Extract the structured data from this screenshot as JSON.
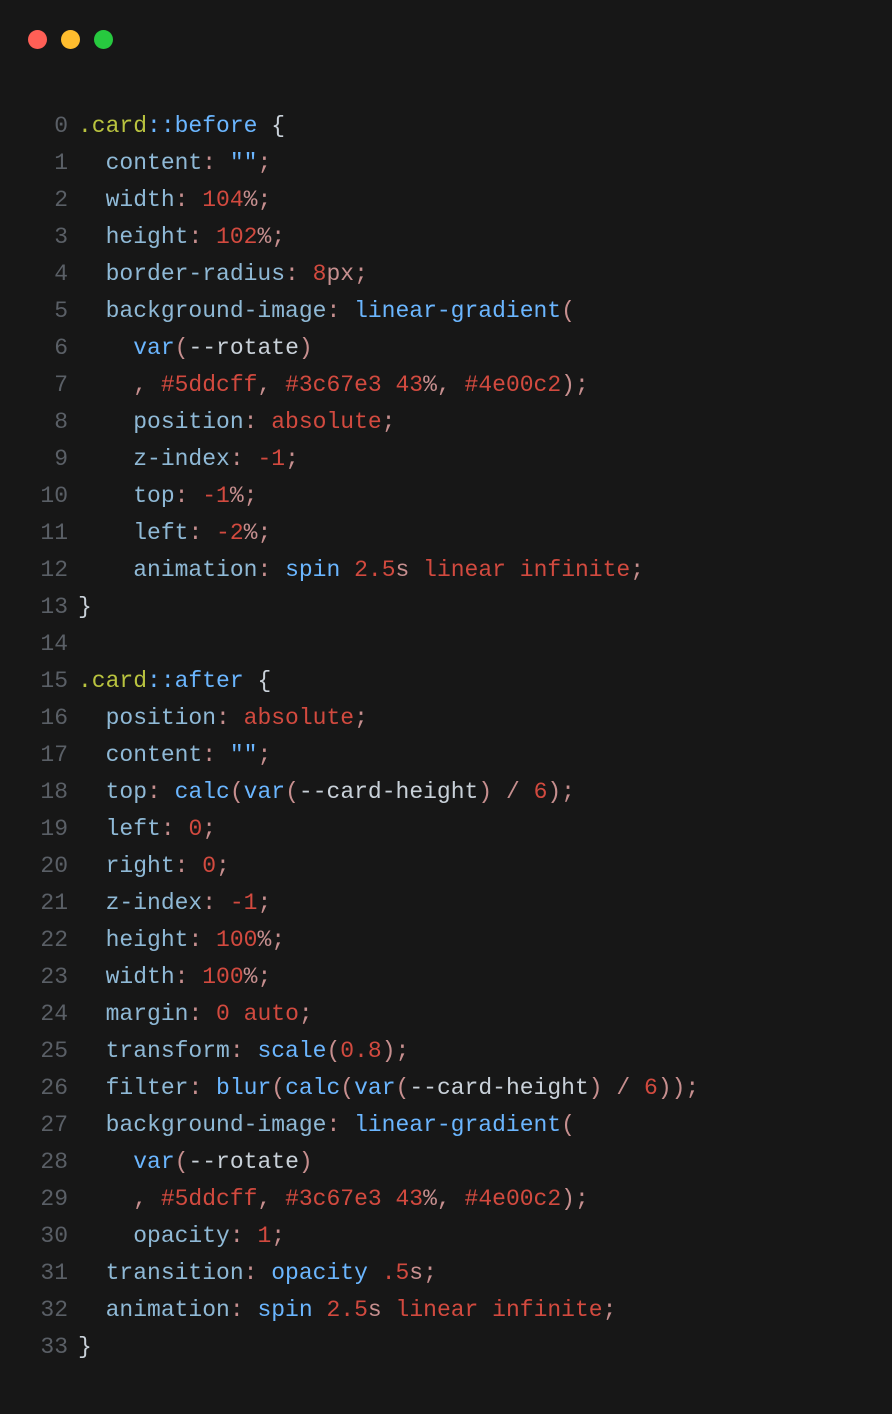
{
  "lines": [
    {
      "n": "0",
      "tokens": [
        [
          "c-sel",
          ".card"
        ],
        [
          "c-pse",
          "::before"
        ],
        [
          "c-brace",
          " {"
        ]
      ]
    },
    {
      "n": "1",
      "tokens": [
        [
          "",
          "  "
        ],
        [
          "c-prop",
          "content"
        ],
        [
          "c-punc",
          ": "
        ],
        [
          "c-str",
          "\"\""
        ],
        [
          "c-punc",
          ";"
        ]
      ]
    },
    {
      "n": "2",
      "tokens": [
        [
          "",
          "  "
        ],
        [
          "c-prop",
          "width"
        ],
        [
          "c-punc",
          ": "
        ],
        [
          "c-num",
          "104"
        ],
        [
          "c-unit",
          "%"
        ],
        [
          "c-punc",
          ";"
        ]
      ]
    },
    {
      "n": "3",
      "tokens": [
        [
          "",
          "  "
        ],
        [
          "c-prop",
          "height"
        ],
        [
          "c-punc",
          ": "
        ],
        [
          "c-num",
          "102"
        ],
        [
          "c-unit",
          "%"
        ],
        [
          "c-punc",
          ";"
        ]
      ]
    },
    {
      "n": "4",
      "tokens": [
        [
          "",
          "  "
        ],
        [
          "c-prop",
          "border-radius"
        ],
        [
          "c-punc",
          ": "
        ],
        [
          "c-num",
          "8"
        ],
        [
          "c-unit",
          "px"
        ],
        [
          "c-punc",
          ";"
        ]
      ]
    },
    {
      "n": "5",
      "tokens": [
        [
          "",
          "  "
        ],
        [
          "c-prop",
          "background-image"
        ],
        [
          "c-punc",
          ": "
        ],
        [
          "c-fn",
          "linear-gradient"
        ],
        [
          "c-punc",
          "("
        ]
      ]
    },
    {
      "n": "6",
      "tokens": [
        [
          "",
          "    "
        ],
        [
          "c-fn",
          "var"
        ],
        [
          "c-punc",
          "("
        ],
        [
          "c-varn",
          "--rotate"
        ],
        [
          "c-punc",
          ")"
        ]
      ]
    },
    {
      "n": "7",
      "tokens": [
        [
          "",
          "    "
        ],
        [
          "c-punc",
          ", "
        ],
        [
          "c-hex",
          "#5ddcff"
        ],
        [
          "c-punc",
          ", "
        ],
        [
          "c-hex",
          "#3c67e3"
        ],
        [
          "",
          " "
        ],
        [
          "c-num",
          "43"
        ],
        [
          "c-unit",
          "%"
        ],
        [
          "c-punc",
          ", "
        ],
        [
          "c-hex",
          "#4e00c2"
        ],
        [
          "c-punc",
          ");"
        ]
      ]
    },
    {
      "n": "8",
      "tokens": [
        [
          "",
          "    "
        ],
        [
          "c-prop",
          "position"
        ],
        [
          "c-punc",
          ": "
        ],
        [
          "c-kw",
          "absolute"
        ],
        [
          "c-punc",
          ";"
        ]
      ]
    },
    {
      "n": "9",
      "tokens": [
        [
          "",
          "    "
        ],
        [
          "c-prop",
          "z-index"
        ],
        [
          "c-punc",
          ": "
        ],
        [
          "c-num",
          "-1"
        ],
        [
          "c-punc",
          ";"
        ]
      ]
    },
    {
      "n": "10",
      "tokens": [
        [
          "",
          "    "
        ],
        [
          "c-prop",
          "top"
        ],
        [
          "c-punc",
          ": "
        ],
        [
          "c-num",
          "-1"
        ],
        [
          "c-unit",
          "%"
        ],
        [
          "c-punc",
          ";"
        ]
      ]
    },
    {
      "n": "11",
      "tokens": [
        [
          "",
          "    "
        ],
        [
          "c-prop",
          "left"
        ],
        [
          "c-punc",
          ": "
        ],
        [
          "c-num",
          "-2"
        ],
        [
          "c-unit",
          "%"
        ],
        [
          "c-punc",
          ";"
        ]
      ]
    },
    {
      "n": "12",
      "tokens": [
        [
          "",
          "    "
        ],
        [
          "c-prop",
          "animation"
        ],
        [
          "c-punc",
          ": "
        ],
        [
          "c-id",
          "spin"
        ],
        [
          "",
          " "
        ],
        [
          "c-num",
          "2.5"
        ],
        [
          "c-unit",
          "s"
        ],
        [
          "",
          " "
        ],
        [
          "c-kw",
          "linear"
        ],
        [
          "",
          " "
        ],
        [
          "c-kw",
          "infinite"
        ],
        [
          "c-punc",
          ";"
        ]
      ]
    },
    {
      "n": "13",
      "tokens": [
        [
          "c-brace",
          "}"
        ]
      ]
    },
    {
      "n": "14",
      "tokens": [
        [
          "",
          ""
        ]
      ]
    },
    {
      "n": "15",
      "tokens": [
        [
          "c-sel",
          ".card"
        ],
        [
          "c-pse",
          "::after"
        ],
        [
          "c-brace",
          " {"
        ]
      ]
    },
    {
      "n": "16",
      "tokens": [
        [
          "",
          "  "
        ],
        [
          "c-prop",
          "position"
        ],
        [
          "c-punc",
          ": "
        ],
        [
          "c-kw",
          "absolute"
        ],
        [
          "c-punc",
          ";"
        ]
      ]
    },
    {
      "n": "17",
      "tokens": [
        [
          "",
          "  "
        ],
        [
          "c-prop",
          "content"
        ],
        [
          "c-punc",
          ": "
        ],
        [
          "c-str",
          "\"\""
        ],
        [
          "c-punc",
          ";"
        ]
      ]
    },
    {
      "n": "18",
      "tokens": [
        [
          "",
          "  "
        ],
        [
          "c-prop",
          "top"
        ],
        [
          "c-punc",
          ": "
        ],
        [
          "c-fn",
          "calc"
        ],
        [
          "c-punc",
          "("
        ],
        [
          "c-fn",
          "var"
        ],
        [
          "c-punc",
          "("
        ],
        [
          "c-varn",
          "--card-height"
        ],
        [
          "c-punc",
          ") / "
        ],
        [
          "c-num",
          "6"
        ],
        [
          "c-punc",
          ");"
        ]
      ]
    },
    {
      "n": "19",
      "tokens": [
        [
          "",
          "  "
        ],
        [
          "c-prop",
          "left"
        ],
        [
          "c-punc",
          ": "
        ],
        [
          "c-num",
          "0"
        ],
        [
          "c-punc",
          ";"
        ]
      ]
    },
    {
      "n": "20",
      "tokens": [
        [
          "",
          "  "
        ],
        [
          "c-prop",
          "right"
        ],
        [
          "c-punc",
          ": "
        ],
        [
          "c-num",
          "0"
        ],
        [
          "c-punc",
          ";"
        ]
      ]
    },
    {
      "n": "21",
      "tokens": [
        [
          "",
          "  "
        ],
        [
          "c-prop",
          "z-index"
        ],
        [
          "c-punc",
          ": "
        ],
        [
          "c-num",
          "-1"
        ],
        [
          "c-punc",
          ";"
        ]
      ]
    },
    {
      "n": "22",
      "tokens": [
        [
          "",
          "  "
        ],
        [
          "c-prop",
          "height"
        ],
        [
          "c-punc",
          ": "
        ],
        [
          "c-num",
          "100"
        ],
        [
          "c-unit",
          "%"
        ],
        [
          "c-punc",
          ";"
        ]
      ]
    },
    {
      "n": "23",
      "tokens": [
        [
          "",
          "  "
        ],
        [
          "c-prop",
          "width"
        ],
        [
          "c-punc",
          ": "
        ],
        [
          "c-num",
          "100"
        ],
        [
          "c-unit",
          "%"
        ],
        [
          "c-punc",
          ";"
        ]
      ]
    },
    {
      "n": "24",
      "tokens": [
        [
          "",
          "  "
        ],
        [
          "c-prop",
          "margin"
        ],
        [
          "c-punc",
          ": "
        ],
        [
          "c-num",
          "0"
        ],
        [
          "",
          " "
        ],
        [
          "c-kw",
          "auto"
        ],
        [
          "c-punc",
          ";"
        ]
      ]
    },
    {
      "n": "25",
      "tokens": [
        [
          "",
          "  "
        ],
        [
          "c-prop",
          "transform"
        ],
        [
          "c-punc",
          ": "
        ],
        [
          "c-fn",
          "scale"
        ],
        [
          "c-punc",
          "("
        ],
        [
          "c-num",
          "0.8"
        ],
        [
          "c-punc",
          ");"
        ]
      ]
    },
    {
      "n": "26",
      "tokens": [
        [
          "",
          "  "
        ],
        [
          "c-prop",
          "filter"
        ],
        [
          "c-punc",
          ": "
        ],
        [
          "c-fn",
          "blur"
        ],
        [
          "c-punc",
          "("
        ],
        [
          "c-fn",
          "calc"
        ],
        [
          "c-punc",
          "("
        ],
        [
          "c-fn",
          "var"
        ],
        [
          "c-punc",
          "("
        ],
        [
          "c-varn",
          "--card-height"
        ],
        [
          "c-punc",
          ") / "
        ],
        [
          "c-num",
          "6"
        ],
        [
          "c-punc",
          "));"
        ]
      ]
    },
    {
      "n": "27",
      "tokens": [
        [
          "",
          "  "
        ],
        [
          "c-prop",
          "background-image"
        ],
        [
          "c-punc",
          ": "
        ],
        [
          "c-fn",
          "linear-gradient"
        ],
        [
          "c-punc",
          "("
        ]
      ]
    },
    {
      "n": "28",
      "tokens": [
        [
          "",
          "    "
        ],
        [
          "c-fn",
          "var"
        ],
        [
          "c-punc",
          "("
        ],
        [
          "c-varn",
          "--rotate"
        ],
        [
          "c-punc",
          ")"
        ]
      ]
    },
    {
      "n": "29",
      "tokens": [
        [
          "",
          "    "
        ],
        [
          "c-punc",
          ", "
        ],
        [
          "c-hex",
          "#5ddcff"
        ],
        [
          "c-punc",
          ", "
        ],
        [
          "c-hex",
          "#3c67e3"
        ],
        [
          "",
          " "
        ],
        [
          "c-num",
          "43"
        ],
        [
          "c-unit",
          "%"
        ],
        [
          "c-punc",
          ", "
        ],
        [
          "c-hex",
          "#4e00c2"
        ],
        [
          "c-punc",
          ");"
        ]
      ]
    },
    {
      "n": "30",
      "tokens": [
        [
          "",
          "    "
        ],
        [
          "c-prop",
          "opacity"
        ],
        [
          "c-punc",
          ": "
        ],
        [
          "c-num",
          "1"
        ],
        [
          "c-punc",
          ";"
        ]
      ]
    },
    {
      "n": "31",
      "tokens": [
        [
          "",
          "  "
        ],
        [
          "c-prop",
          "transition"
        ],
        [
          "c-punc",
          ": "
        ],
        [
          "c-id",
          "opacity"
        ],
        [
          "",
          " "
        ],
        [
          "c-num",
          ".5"
        ],
        [
          "c-unit",
          "s"
        ],
        [
          "c-punc",
          ";"
        ]
      ]
    },
    {
      "n": "32",
      "tokens": [
        [
          "",
          "  "
        ],
        [
          "c-prop",
          "animation"
        ],
        [
          "c-punc",
          ": "
        ],
        [
          "c-id",
          "spin"
        ],
        [
          "",
          " "
        ],
        [
          "c-num",
          "2.5"
        ],
        [
          "c-unit",
          "s"
        ],
        [
          "",
          " "
        ],
        [
          "c-kw",
          "linear"
        ],
        [
          "",
          " "
        ],
        [
          "c-kw",
          "infinite"
        ],
        [
          "c-punc",
          ";"
        ]
      ]
    },
    {
      "n": "33",
      "tokens": [
        [
          "c-brace",
          "}"
        ]
      ]
    }
  ]
}
